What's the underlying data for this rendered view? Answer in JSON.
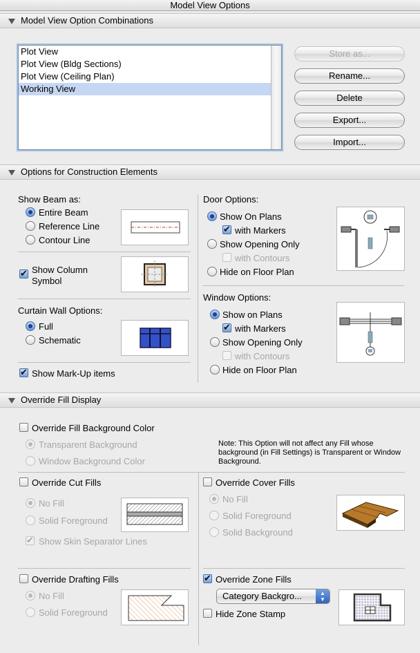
{
  "window": {
    "title": "Model View Options"
  },
  "combinations": {
    "header": "Model View Option Combinations",
    "list": [
      "Plot View",
      "Plot View (Bldg Sections)",
      "Plot View (Ceiling Plan)",
      "Working View"
    ],
    "selected_index": 3,
    "buttons": {
      "store": "Store as...",
      "rename": "Rename...",
      "delete": "Delete",
      "export": "Export...",
      "import": "Import..."
    }
  },
  "construction": {
    "header": "Options for Construction Elements",
    "beam": {
      "label": "Show Beam as:",
      "entire": "Entire Beam",
      "reference": "Reference Line",
      "contour": "Contour Line",
      "selected": "entire"
    },
    "column": {
      "label_line1": "Show Column",
      "label_line2": "Symbol",
      "checked": true
    },
    "curtain": {
      "label": "Curtain Wall Options:",
      "full": "Full",
      "schematic": "Schematic",
      "selected": "full"
    },
    "markup": {
      "label": "Show Mark-Up items",
      "checked": true
    },
    "door": {
      "label": "Door Options:",
      "show_on_plans": "Show On Plans",
      "with_markers": "with Markers",
      "show_opening_only": "Show Opening Only",
      "with_contours": "with Contours",
      "hide": "Hide on Floor Plan"
    },
    "window_opts": {
      "label": "Window Options:",
      "show_on_plans": "Show on Plans",
      "with_markers": "with Markers",
      "show_opening_only": "Show Opening Only",
      "with_contours": "with Contours",
      "hide": "Hide on Floor Plan"
    }
  },
  "fill": {
    "header": "Override Fill Display",
    "background": {
      "label": "Override Fill Background Color",
      "transparent": "Transparent Background",
      "window": "Window Background Color",
      "note": "Note: This Option will not affect any Fill whose background (in Fill Settings) is Transparent or Window Background."
    },
    "cut": {
      "label": "Override Cut Fills",
      "no_fill": "No Fill",
      "solid_fg": "Solid Foreground",
      "skin": "Show Skin Separator Lines"
    },
    "cover": {
      "label": "Override Cover Fills",
      "no_fill": "No Fill",
      "solid_fg": "Solid Foreground",
      "solid_bg": "Solid Background"
    },
    "drafting": {
      "label": "Override Drafting Fills",
      "no_fill": "No Fill",
      "solid_fg": "Solid Foreground"
    },
    "zone": {
      "label": "Override Zone Fills",
      "select_value": "Category Backgro...",
      "hide_stamp": "Hide Zone Stamp"
    }
  },
  "colors": {
    "selection": "#c6d7f3",
    "focus_ring": "#9ec0ea",
    "accent": "#2f63c0",
    "curtain_panel": "#3452c8"
  }
}
